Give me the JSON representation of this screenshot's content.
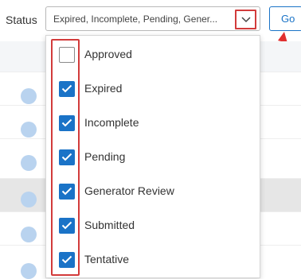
{
  "filter": {
    "label": "Status",
    "selected_text": "Expired, Incomplete, Pending, Gener...",
    "go_label": "Go"
  },
  "options": [
    {
      "label": "Approved",
      "checked": false
    },
    {
      "label": "Expired",
      "checked": true
    },
    {
      "label": "Incomplete",
      "checked": true
    },
    {
      "label": "Pending",
      "checked": true
    },
    {
      "label": "Generator Review",
      "checked": true
    },
    {
      "label": "Submitted",
      "checked": true
    },
    {
      "label": "Tentative",
      "checked": true
    }
  ],
  "colors": {
    "accent": "#1a73c7",
    "highlight": "#d23b3b"
  }
}
